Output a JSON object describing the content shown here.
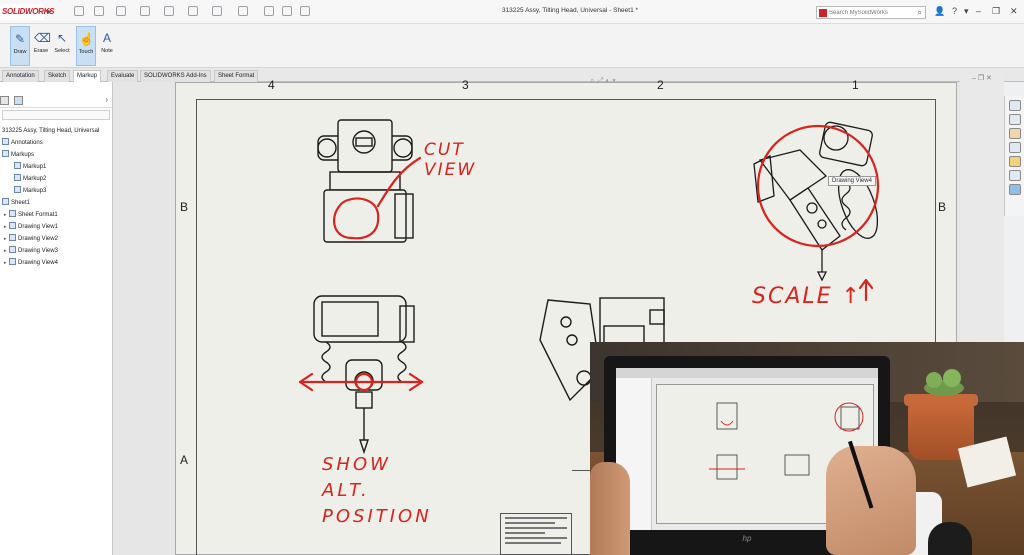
{
  "app": {
    "logo_text": "SOLIDWORKS",
    "document_title": "313225 Assy, Tilting Head, Universal - Sheet1 *",
    "search_placeholder": "Search MySolidWorks",
    "brand_color": "#d0202a"
  },
  "ribbon": {
    "tools": [
      {
        "label": "Draw",
        "icon": "pen-icon",
        "active": true
      },
      {
        "label": "Erase",
        "icon": "eraser-icon",
        "active": false
      },
      {
        "label": "Select",
        "icon": "cursor-icon",
        "active": false
      },
      {
        "label": "Touch",
        "icon": "hand-icon",
        "active": true
      },
      {
        "label": "Note",
        "icon": "note-icon",
        "active": false
      }
    ]
  },
  "tabs": [
    {
      "label": "Annotation",
      "active": false
    },
    {
      "label": "Sketch",
      "active": false
    },
    {
      "label": "Markup",
      "active": true
    },
    {
      "label": "Evaluate",
      "active": false
    },
    {
      "label": "SOLIDWORKS Add-Ins",
      "active": false
    },
    {
      "label": "Sheet Format",
      "active": false
    }
  ],
  "feature_tree": {
    "root": "313225 Assy, Tilting Head, Universal",
    "items": [
      {
        "label": "Annotations",
        "level": 0
      },
      {
        "label": "Markups",
        "level": 0
      },
      {
        "label": "Markup1",
        "level": 1
      },
      {
        "label": "Markup2",
        "level": 1
      },
      {
        "label": "Markup3",
        "level": 1
      },
      {
        "label": "Sheet1",
        "level": 0
      },
      {
        "label": "Sheet Format1",
        "level": 1
      },
      {
        "label": "Drawing View1",
        "level": 1
      },
      {
        "label": "Drawing View2",
        "level": 1
      },
      {
        "label": "Drawing View3",
        "level": 1
      },
      {
        "label": "Drawing View4",
        "level": 1
      }
    ]
  },
  "sheet": {
    "zones_top": [
      "4",
      "3",
      "2",
      "1"
    ],
    "zones_side_left": [
      "B",
      "A"
    ],
    "zones_side_right": [
      "B"
    ],
    "tooltip": "Drawing View4"
  },
  "markup_notes": {
    "cut_view": [
      "CUT",
      "VIEW"
    ],
    "scale": "SCALE ↑",
    "show_alt": [
      "SHOW",
      "ALT.",
      "POSITION"
    ],
    "ink_color": "#d8231e"
  }
}
